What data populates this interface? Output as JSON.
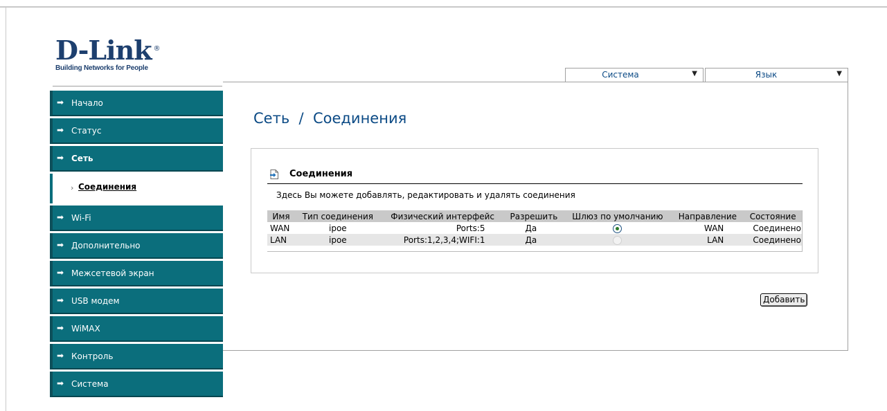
{
  "logo": {
    "brand": "D-Link",
    "tagline": "Building Networks for People",
    "reg": "®"
  },
  "topbar": {
    "system_label": "Система",
    "language_label": "Язык"
  },
  "sidebar": {
    "items": [
      {
        "label": "Начало"
      },
      {
        "label": "Статус"
      },
      {
        "label": "Сеть",
        "bold": true
      },
      {
        "label": "Wi-Fi"
      },
      {
        "label": "Дополнительно"
      },
      {
        "label": "Межсетевой экран"
      },
      {
        "label": "USB модем"
      },
      {
        "label": "WiMAX"
      },
      {
        "label": "Контроль"
      },
      {
        "label": "Система"
      }
    ],
    "sub_item": {
      "bullet": "›",
      "label": "Соединения"
    }
  },
  "page": {
    "title": "Сеть  /  Соединения",
    "section_title": "Соединения",
    "section_desc": "Здесь Вы можете добавлять, редактировать и удалять соединения",
    "add_button": "Добавить"
  },
  "table": {
    "headers": [
      "Имя",
      "Тип соединения",
      "Физический интерфейс",
      "Разрешить",
      "Шлюз по умолчанию",
      "Направление",
      "Состояние"
    ],
    "rows": [
      {
        "name": "WAN",
        "type": "ipoe",
        "phys": "Ports:5",
        "enabled": "Да",
        "gateway": "selected",
        "direction": "WAN",
        "status": "Соединено"
      },
      {
        "name": "LAN",
        "type": "ipoe",
        "phys": "Ports:1,2,3,4;WIFI:1",
        "enabled": "Да",
        "gateway": "disabled",
        "direction": "LAN",
        "status": "Соединено"
      }
    ]
  },
  "colors": {
    "nav_bg": "#0b6e7c",
    "title": "#0b4a85",
    "header_bg": "#c9c9c9"
  }
}
